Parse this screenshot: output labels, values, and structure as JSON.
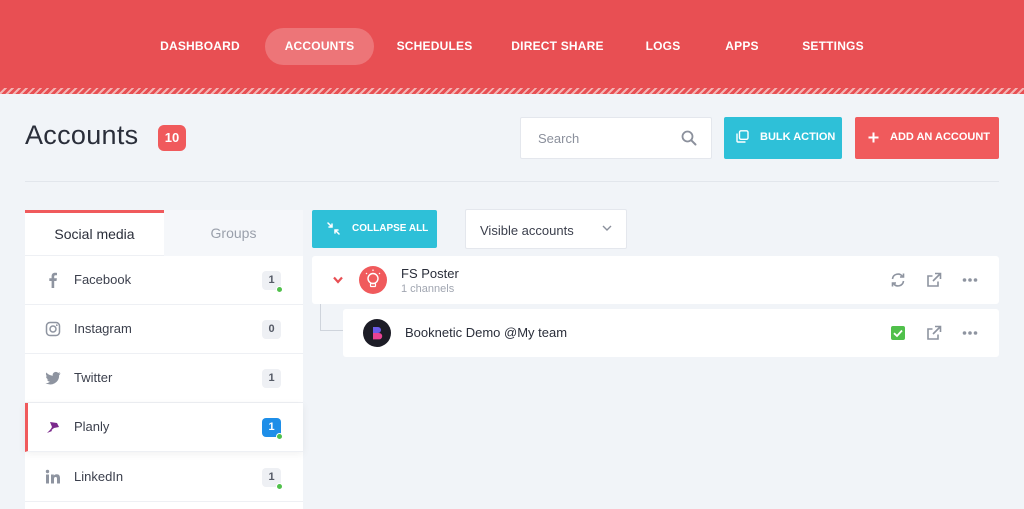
{
  "nav": {
    "items": [
      "DASHBOARD",
      "ACCOUNTS",
      "SCHEDULES",
      "DIRECT SHARE",
      "LOGS",
      "APPS",
      "SETTINGS"
    ],
    "active": "ACCOUNTS"
  },
  "header": {
    "title": "Accounts",
    "count": "10",
    "search_placeholder": "Search",
    "bulk_action_label": "BULK ACTION",
    "add_account_label": "ADD AN ACCOUNT"
  },
  "side": {
    "tabs": {
      "social": "Social media",
      "groups": "Groups"
    },
    "networks": [
      {
        "name": "Facebook",
        "count": "1",
        "icon": "facebook-icon"
      },
      {
        "name": "Instagram",
        "count": "0",
        "icon": "instagram-icon"
      },
      {
        "name": "Twitter",
        "count": "1",
        "icon": "twitter-icon"
      },
      {
        "name": "Planly",
        "count": "1",
        "icon": "planly-icon"
      },
      {
        "name": "LinkedIn",
        "count": "1",
        "icon": "linkedin-icon"
      }
    ]
  },
  "content": {
    "collapse_label": "COLLAPSE ALL",
    "visible_label": "Visible accounts",
    "parent": {
      "name": "FS Poster",
      "channels": "1 channels"
    },
    "child": {
      "name": "Booknetic Demo @My team",
      "avatar_letter": "B"
    }
  },
  "colors": {
    "brand_red": "#e84f53",
    "accent_cyan": "#2ec0d8",
    "badge_red": "#f05a5c",
    "check_green": "#50c04b",
    "planly_blue": "#1e8ee8"
  }
}
